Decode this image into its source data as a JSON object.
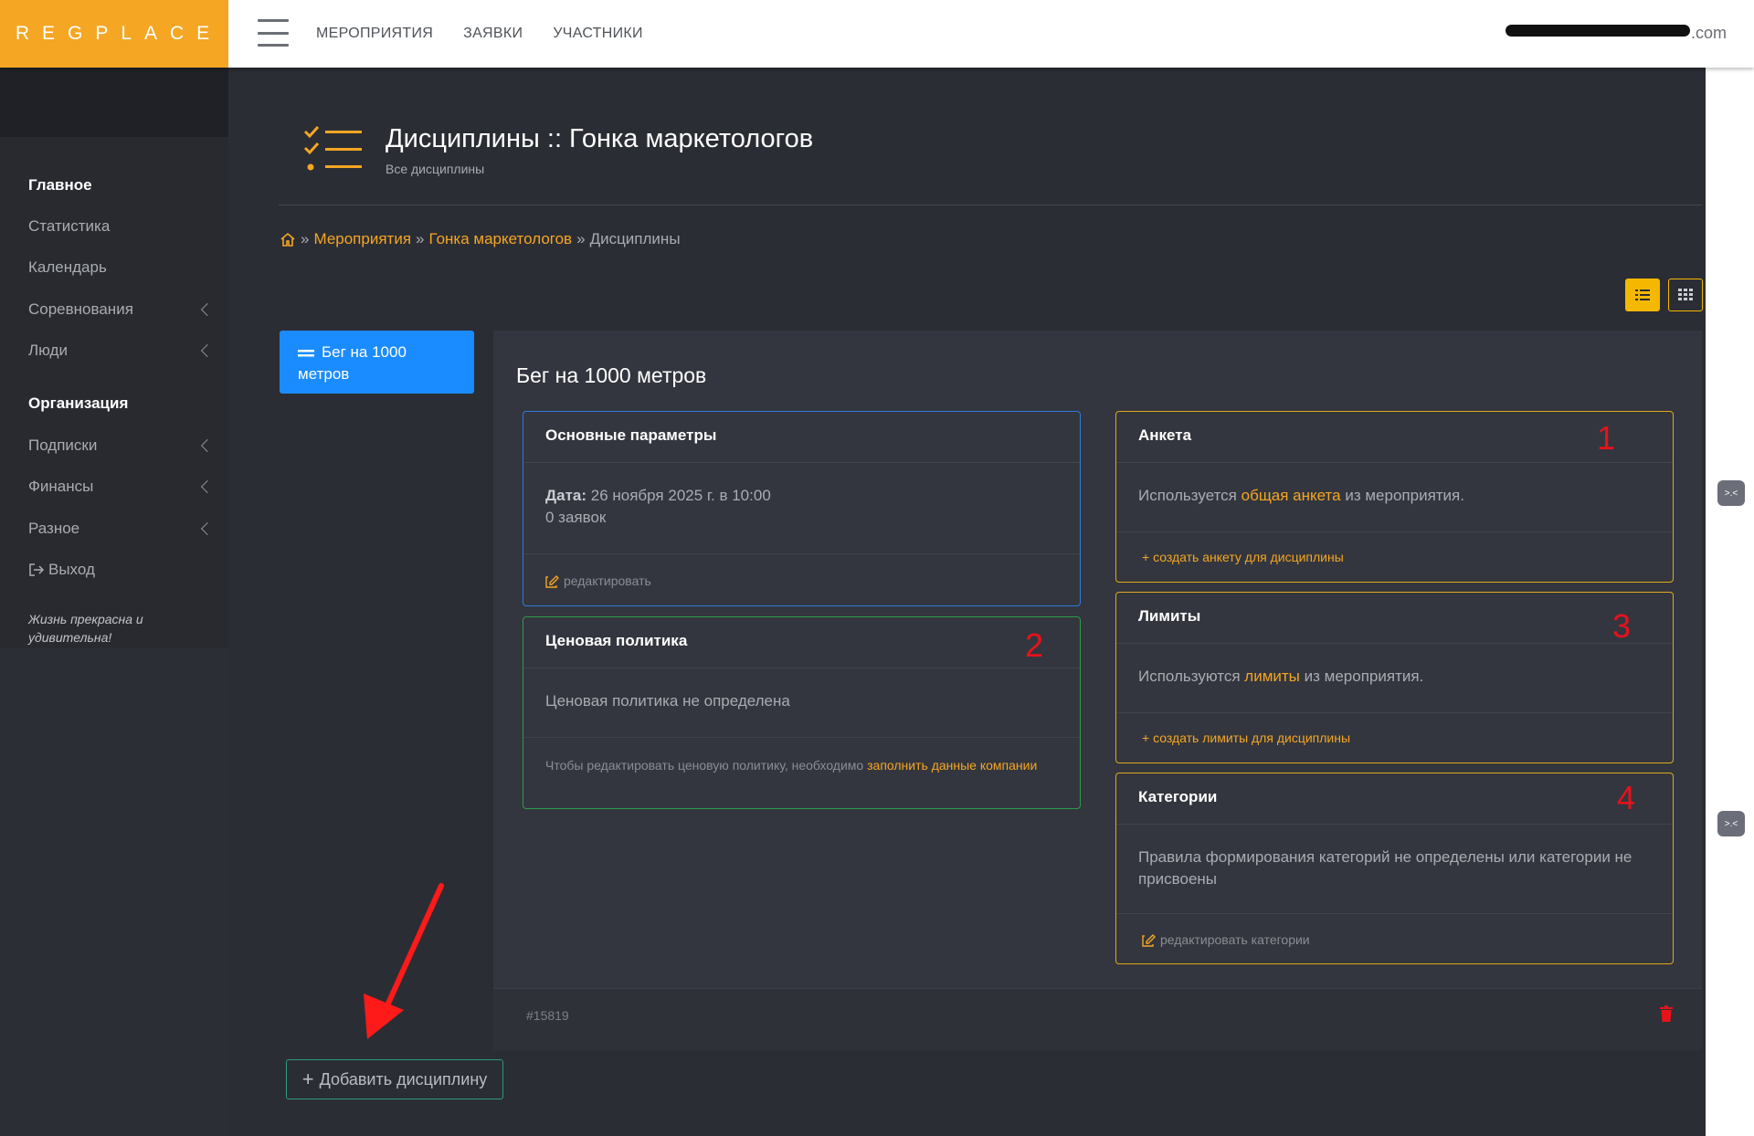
{
  "brand": {
    "logo": "REGPLACE",
    "accent": "#f5a623"
  },
  "topnav": [
    {
      "label": "МЕРОПРИЯТИЯ"
    },
    {
      "label": "ЗАЯВКИ"
    },
    {
      "label": "УЧАСТНИКИ"
    }
  ],
  "user": {
    "email_suffix": ".com"
  },
  "sidebar": {
    "sections": [
      "Главное",
      "Организация"
    ],
    "items": [
      {
        "label": "Статистика"
      },
      {
        "label": "Календарь"
      },
      {
        "label": "Соревнования"
      },
      {
        "label": "Люди"
      },
      {
        "label": "Подписки"
      },
      {
        "label": "Финансы"
      },
      {
        "label": "Разное"
      },
      {
        "label": "Выход"
      }
    ],
    "quote": "Жизнь прекрасна и удивительна!"
  },
  "page": {
    "title": "Дисциплины :: Гонка маркетологов",
    "subtitle": "Все дисциплины"
  },
  "breadcrumb": {
    "sep": "»",
    "link1": "Мероприятия",
    "link2": "Гонка маркетологов",
    "current": "Дисциплины"
  },
  "discipline_tab": {
    "label": "Бег на 1000 метров"
  },
  "panel": {
    "title": "Бег на 1000 метров",
    "id": "#15819"
  },
  "cards": {
    "main_params": {
      "title": "Основные параметры",
      "date_label": "Дата:",
      "date_value": "26 ноября 2025 г. в 10:00",
      "applications": "0 заявок",
      "edit": "редактировать"
    },
    "pricing": {
      "title": "Ценовая политика",
      "body": "Ценовая политика не определена",
      "note": "Чтобы редактировать ценовую политику, необходимо",
      "note_link": "заполнить данные компании",
      "marker": "2"
    },
    "survey": {
      "title": "Анкета",
      "body_pre": "Используется",
      "body_link": "общая анкета",
      "body_post": "из мероприятия.",
      "action": "создать анкету для дисциплины",
      "marker": "1"
    },
    "limits": {
      "title": "Лимиты",
      "body_pre": "Используются",
      "body_link": "лимиты",
      "body_post": "из мероприятия.",
      "action": "создать лимиты для дисциплины",
      "marker": "3"
    },
    "categories": {
      "title": "Категории",
      "body": "Правила формирования категорий не определены или категории не присвоены",
      "action": "редактировать категории",
      "marker": "4"
    }
  },
  "add_button": {
    "label": "Добавить дисциплину"
  },
  "side_bubble": {
    "text": ">.<"
  }
}
